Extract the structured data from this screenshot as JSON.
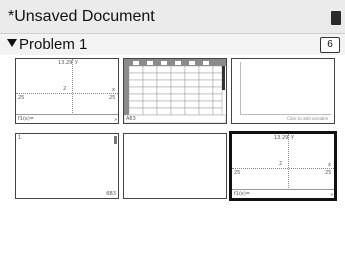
{
  "document": {
    "title": "*Unsaved Document"
  },
  "problem": {
    "title": "Problem 1",
    "page_count": "6"
  },
  "pages": [
    {
      "type": "graph",
      "x_min": "25",
      "x_max": "25",
      "y_max": "13.29",
      "y_axis": "y",
      "x_axis": "x",
      "mid_tick": "2",
      "entry_label": "f1(x)="
    },
    {
      "type": "spreadsheet",
      "cell_label": "A63"
    },
    {
      "type": "data-and-stats",
      "hint": "Click to add variable"
    },
    {
      "type": "notes",
      "line_number": "1",
      "corner_value": "6B3"
    },
    {
      "type": "blank"
    },
    {
      "type": "graph",
      "x_min": "25",
      "x_max": "25",
      "y_max": "13.29",
      "y_axis": "y",
      "x_axis": "x",
      "mid_tick": "2",
      "entry_label": "f1(x)="
    }
  ]
}
